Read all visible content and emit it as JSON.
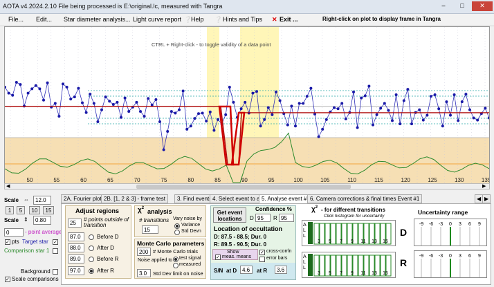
{
  "window": {
    "title": "AOTA v4.2024.2.10    File being processed is E:\\original.lc, measured with Tangra"
  },
  "menu": {
    "file": "File...",
    "edit": "Edit...",
    "star_diameter": "Star diameter analysis...",
    "light_curve": "Light curve report",
    "help": "Help",
    "hints": "Hints and Tips",
    "exit": "Exit ...",
    "right_click_hint": "Right-click on plot to display frame in Tangra"
  },
  "chart": {
    "hint": "CTRL + Right-click   -  to toggle validity of a data point",
    "x_ticks": [
      "50",
      "55",
      "60",
      "65",
      "70",
      "75",
      "80",
      "85",
      "90",
      "95",
      "100",
      "105",
      "110",
      "115",
      "120",
      "125",
      "130",
      "135"
    ],
    "colors": {
      "points": "#1a1aa8",
      "model": "#b01010",
      "comparison": "#2e8b2e",
      "band": "#f6dfb4",
      "event_zone": "#fff6b8"
    },
    "points": [
      118,
      129,
      133,
      109,
      113,
      153,
      129,
      121,
      115,
      121,
      142,
      110,
      155,
      148,
      172,
      112,
      118,
      140,
      136,
      120,
      147,
      165,
      131,
      148,
      182,
      160,
      136,
      144,
      150,
      146,
      174,
      138,
      163,
      155,
      146,
      163,
      172,
      139,
      151,
      141,
      182,
      234,
      200,
      163,
      166,
      160,
      125,
      196,
      190,
      176,
      167,
      166,
      181,
      164,
      198,
      178,
      186,
      169,
      118,
      146,
      174,
      158,
      146,
      166,
      129,
      126,
      190,
      178,
      156,
      169,
      127,
      143,
      167,
      188,
      153,
      190,
      148,
      148,
      135,
      120,
      168,
      210,
      196,
      178,
      164,
      156,
      158,
      148,
      177,
      165,
      127,
      193,
      138,
      134,
      116,
      188,
      169,
      157,
      148,
      161,
      180,
      132,
      186,
      143,
      122,
      186,
      165,
      160,
      179,
      170,
      135,
      132,
      158,
      190,
      145,
      170,
      132,
      180,
      145,
      131,
      160,
      175,
      179,
      167,
      157,
      175
    ]
  },
  "left": {
    "scale_label": "Scale",
    "scale_value": "12.0",
    "btn1": "1",
    "btn5": "5",
    "btn10": "10",
    "btn15": "15",
    "scale2_label": "Scale",
    "scale2_value": "0.80",
    "avg_value": "0",
    "avg_label": "- point average",
    "pts_label": "pts",
    "target_label": "Target star",
    "comparison_label": "Comparison star 1",
    "background_label": "Background",
    "scale_comparisons": "Scale comparisons"
  },
  "tabs": [
    "2A. Fourier plot",
    "2B. [1, 2 & 3] - frame test",
    "3. Find events",
    "4. Select event to analyse",
    "5. Analyse event #1",
    "6. Camera corrections & final times Event #1"
  ],
  "adjust": {
    "title": "Adjust regions",
    "points_value": "25",
    "points_label": "# points outside of transition",
    "before_d_value": "87.0",
    "before_d": "Before D",
    "after_d_value": "88.0",
    "after_d": "After D",
    "before_r_value": "89.0",
    "before_r": "Before R",
    "after_r_value": "97.0",
    "after_r": "After R"
  },
  "chi": {
    "title": "analysis",
    "transitions_label": "# transitions",
    "transitions_value": "15",
    "vary_label": "Vary noise by",
    "variance": "Variance",
    "stddev": "Std Devn"
  },
  "monte": {
    "title": "Monte Carlo parameters",
    "trials_value": "200",
    "trials_label": "# Monte Carlo trials",
    "noise_label": "Noise applied to",
    "test_signal": "test signal",
    "measured": "measured",
    "std_value": "3.0",
    "std_label": "Std Dev limit on noise"
  },
  "occultation": {
    "get_btn": "Get event locations",
    "conf_title": "Confidence %",
    "d_label": "D",
    "d_value": "95",
    "r_label": "R",
    "r_value": "95",
    "loc_title": "Location of occultation",
    "d_line": "D: 87.5 - 88.5; Dur. 0",
    "r_line": "R: 89.5 - 90.5; Dur. 0",
    "show_label": "Show",
    "meas_means": "meas. means",
    "cross_corr": "cross-corrln",
    "error_bars": "error bars",
    "sn_label": "S/N",
    "at_d": "at D",
    "sn_d": "4.6",
    "at_r": "at R",
    "sn_r": "3.6"
  },
  "transitions": {
    "title": "- for different transitions",
    "subtitle": "Click histogram for uncertainty",
    "axis_labels": [
      "A",
      "L",
      "L"
    ],
    "ticks": [
      "3",
      "5",
      "7",
      "9",
      "11",
      "13",
      "15"
    ],
    "d_label": "D",
    "r_label": "R"
  },
  "uncertainty": {
    "title": "Uncertainty range",
    "ticks": [
      "-9",
      "-6",
      "-3",
      "0",
      "3",
      "6",
      "9"
    ]
  }
}
